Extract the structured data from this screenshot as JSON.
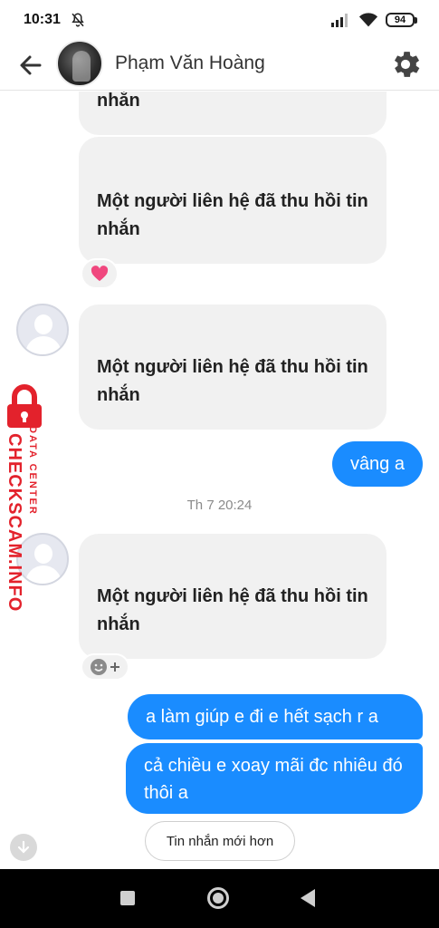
{
  "status_bar": {
    "time": "10:31",
    "battery": "94"
  },
  "header": {
    "contact_name": "Phạm Văn Hoàng"
  },
  "messages": [
    {
      "direction": "incoming",
      "text": "Một người liên hệ đã thu hồi tin nhắn"
    },
    {
      "direction": "incoming",
      "text": "Một người liên hệ đã thu hồi tin nhắn",
      "reaction": "heart"
    },
    {
      "direction": "incoming",
      "text": "Một người liên hệ đã thu hồi tin nhắn"
    },
    {
      "direction": "outgoing",
      "text": "vâng a"
    },
    {
      "direction": "incoming",
      "text": "Một người liên hệ đã thu hồi tin nhắn"
    },
    {
      "direction": "outgoing",
      "text": "a làm giúp e đi e hết sạch r a"
    },
    {
      "direction": "outgoing",
      "text": "cả chiều e xoay mãi đc nhiêu đó thôi a"
    }
  ],
  "timestamp": "Th 7 20:24",
  "newer_messages_button": "Tin nhắn mới hơn",
  "watermark": {
    "brand": "CHECKSCAM.INFO",
    "tag": "DATA CENTER"
  },
  "colors": {
    "outgoing_bubble": "#1a8cff",
    "incoming_bubble": "#f1f1f1",
    "watermark": "#e3222c"
  }
}
